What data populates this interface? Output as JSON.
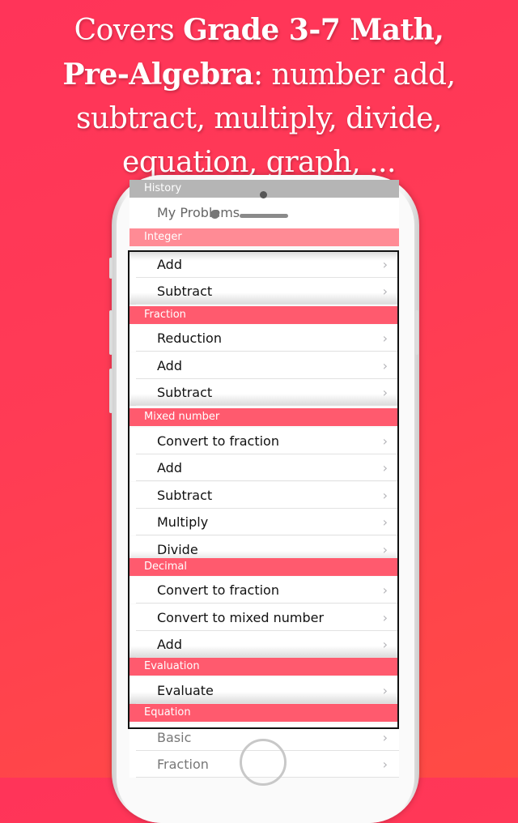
{
  "headline": {
    "line1_normal": "Covers ",
    "line1_bold": "Grade 3-7 Math,",
    "line2_bold": "Pre-Algebra",
    "line2_normal": ": number add,",
    "line3": "subtract, multiply, divide,",
    "line4": "equation, graph, ..."
  },
  "colors": {
    "background_top": "#ff3459",
    "background_bottom": "#ff4b44",
    "section_header": "#ff5a6e",
    "section_header_light": "#ff8b95",
    "section_header_gray": "#b5b5b5"
  },
  "sections": [
    {
      "title": "History",
      "items": [
        "My Problems"
      ]
    },
    {
      "title": "Integer",
      "items": [
        "Add",
        "Subtract"
      ]
    },
    {
      "title": "Fraction",
      "items": [
        "Reduction",
        "Add",
        "Subtract"
      ]
    },
    {
      "title": "Mixed number",
      "items": [
        "Convert to fraction",
        "Add",
        "Subtract",
        "Multiply",
        "Divide"
      ]
    },
    {
      "title": "Decimal",
      "items": [
        "Convert to fraction",
        "Convert to mixed number",
        "Add"
      ]
    },
    {
      "title": "Evaluation",
      "items": [
        "Evaluate"
      ]
    },
    {
      "title": "Equation",
      "items": [
        "Basic",
        "Fraction"
      ]
    }
  ],
  "chevron_icon": "›"
}
